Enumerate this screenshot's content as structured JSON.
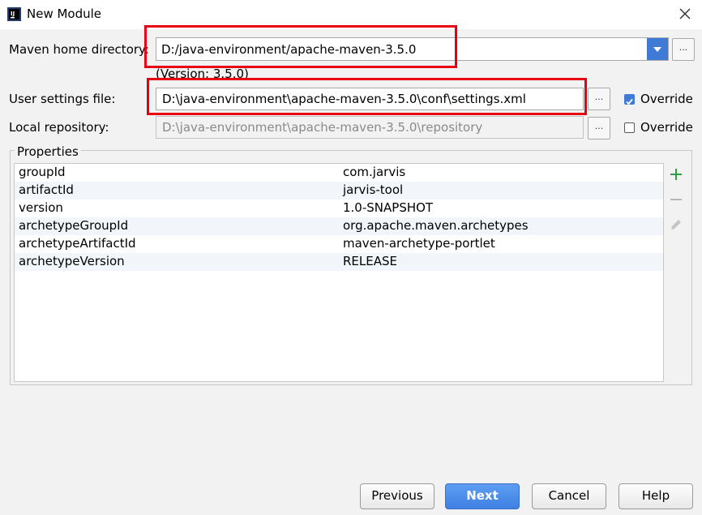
{
  "window": {
    "title": "New Module"
  },
  "maven_home": {
    "label": "Maven home directory:",
    "value": "D:/java-environment/apache-maven-3.5.0",
    "version": "(Version: 3.5.0)"
  },
  "user_settings": {
    "label": "User settings file:",
    "value": "D:\\java-environment\\apache-maven-3.5.0\\conf\\settings.xml",
    "override_label": "Override",
    "override_checked": true
  },
  "local_repo": {
    "label": "Local repository:",
    "value": "D:\\java-environment\\apache-maven-3.5.0\\repository",
    "override_label": "Override",
    "override_checked": false
  },
  "browse_label": "...",
  "properties": {
    "title": "Properties",
    "rows": [
      {
        "key": "groupId",
        "value": "com.jarvis"
      },
      {
        "key": "artifactId",
        "value": "jarvis-tool"
      },
      {
        "key": "version",
        "value": "1.0-SNAPSHOT"
      },
      {
        "key": "archetypeGroupId",
        "value": "org.apache.maven.archetypes"
      },
      {
        "key": "archetypeArtifactId",
        "value": "maven-archetype-portlet"
      },
      {
        "key": "archetypeVersion",
        "value": "RELEASE"
      }
    ]
  },
  "buttons": {
    "previous": "Previous",
    "next": "Next",
    "cancel": "Cancel",
    "help": "Help"
  },
  "icons": {
    "app": "intellij-icon",
    "close": "close-icon",
    "add": "plus-icon",
    "remove": "minus-icon",
    "edit": "pencil-icon"
  },
  "colors": {
    "accent": "#3f7bd6",
    "highlight_box": "#e60012",
    "add": "#2ea043"
  }
}
